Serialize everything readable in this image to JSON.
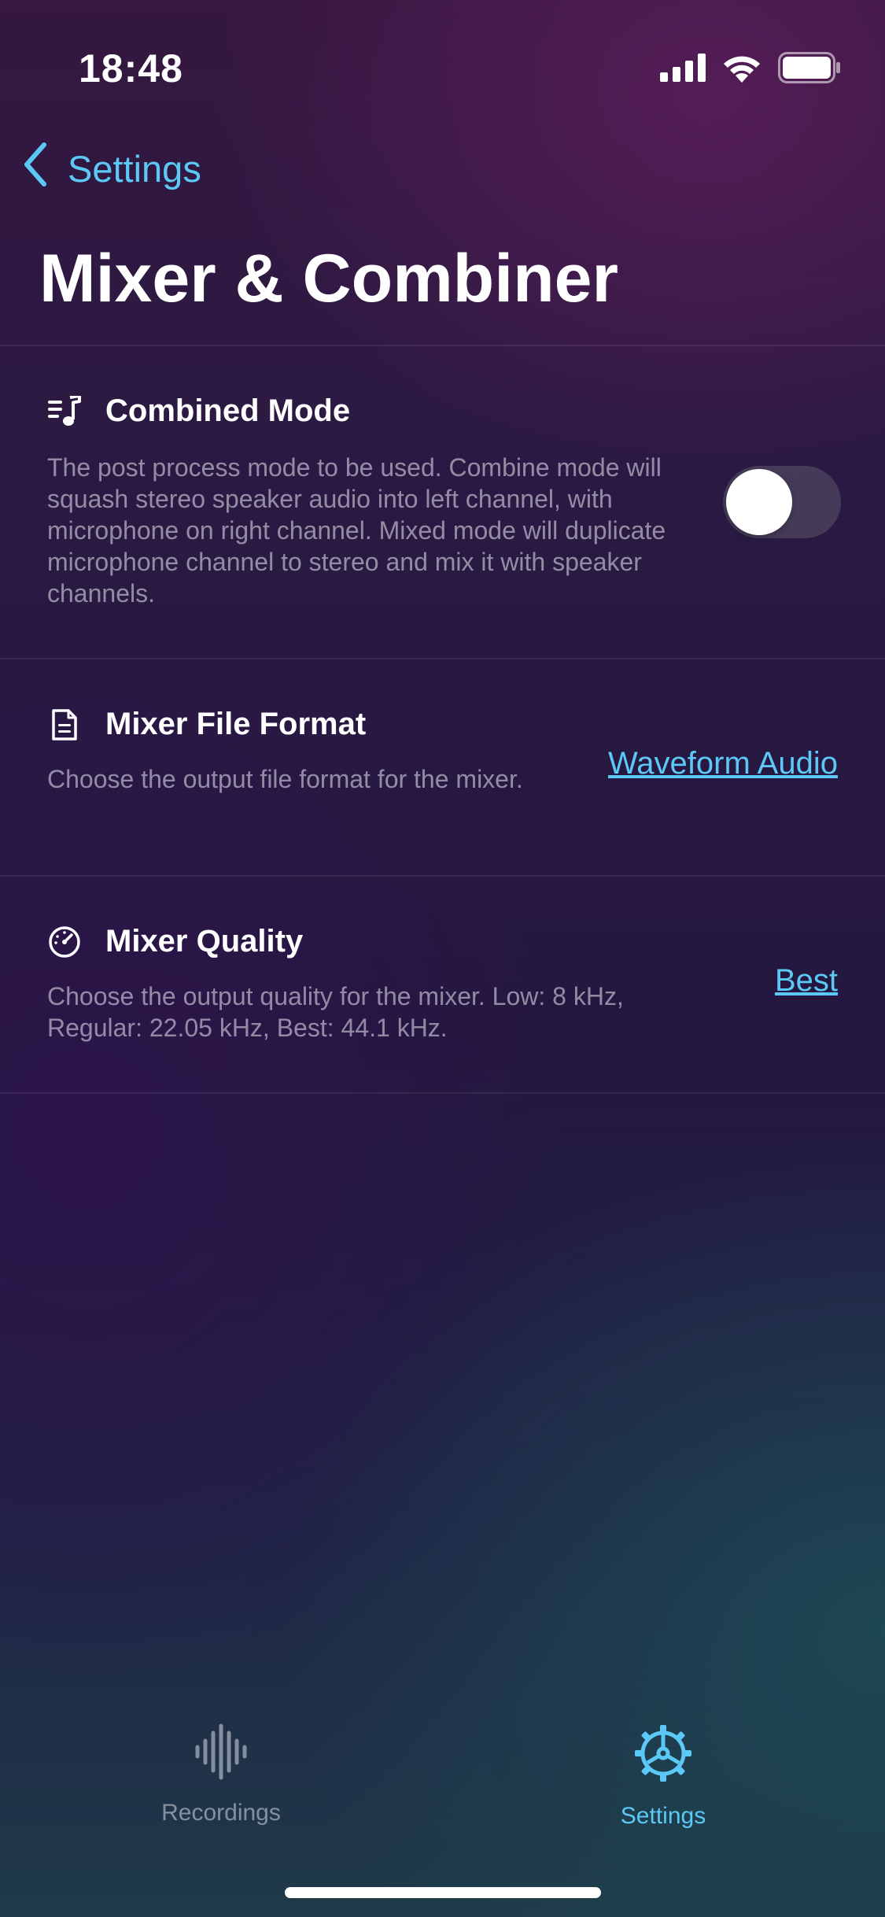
{
  "status_bar": {
    "time": "18:48"
  },
  "nav": {
    "back_label": "Settings",
    "title": "Mixer & Combiner"
  },
  "colors": {
    "accent": "#5cc8f5",
    "toggle_off_track": "#4a4a57",
    "secondary_text": "#8e8a9e"
  },
  "settings": {
    "combined_mode": {
      "icon": "music-list-icon",
      "title": "Combined Mode",
      "description": "The post process mode to be used. Combine mode will squash stereo speaker audio into left channel, with microphone on right channel. Mixed mode will duplicate microphone channel to stereo and mix it with speaker channels.",
      "enabled": false
    },
    "file_format": {
      "icon": "document-icon",
      "title": "Mixer File Format",
      "description": "Choose the output file format for the mixer.",
      "value": "Waveform Audio"
    },
    "quality": {
      "icon": "speedometer-icon",
      "title": "Mixer Quality",
      "description": "Choose the output quality for the mixer. Low: 8 kHz, Regular: 22.05 kHz, Best: 44.1 kHz.",
      "value": "Best"
    }
  },
  "tab_bar": {
    "tabs": [
      {
        "label": "Recordings",
        "icon": "waveform-icon",
        "selected": false
      },
      {
        "label": "Settings",
        "icon": "gear-icon",
        "selected": true
      }
    ]
  }
}
